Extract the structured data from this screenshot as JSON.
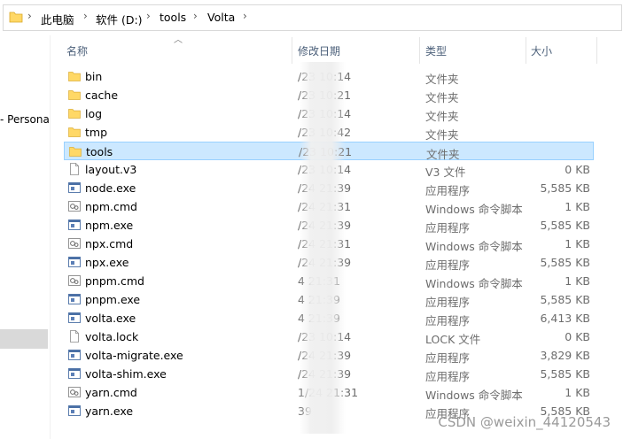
{
  "address_bar": {
    "crumbs": [
      "此电脑",
      "软件 (D:)",
      "tools",
      "Volta"
    ]
  },
  "nav": {
    "item_label": "- Persona"
  },
  "columns": {
    "name": "名称",
    "date": "修改日期",
    "type": "类型",
    "size": "大小"
  },
  "files": [
    {
      "name": "bin",
      "date": "/23 10:14",
      "type": "文件夹",
      "size": "",
      "icon": "folder-icon"
    },
    {
      "name": "cache",
      "date": "/23 10:21",
      "type": "文件夹",
      "size": "",
      "icon": "folder-icon"
    },
    {
      "name": "log",
      "date": "/23 10:14",
      "type": "文件夹",
      "size": "",
      "icon": "folder-icon"
    },
    {
      "name": "tmp",
      "date": "/23 10:42",
      "type": "文件夹",
      "size": "",
      "icon": "folder-icon"
    },
    {
      "name": "tools",
      "date": "/23 10:21",
      "type": "文件夹",
      "size": "",
      "icon": "folder-icon",
      "selected": true
    },
    {
      "name": "layout.v3",
      "date": "/23 10:14",
      "type": "V3 文件",
      "size": "0 KB",
      "icon": "file-icon"
    },
    {
      "name": "node.exe",
      "date": "/24 21:39",
      "type": "应用程序",
      "size": "5,585 KB",
      "icon": "exe-icon"
    },
    {
      "name": "npm.cmd",
      "date": "/24 21:31",
      "type": "Windows 命令脚本",
      "size": "1 KB",
      "icon": "cmd-icon"
    },
    {
      "name": "npm.exe",
      "date": "/24 21:39",
      "type": "应用程序",
      "size": "5,585 KB",
      "icon": "exe-icon"
    },
    {
      "name": "npx.cmd",
      "date": "/24 21:31",
      "type": "Windows 命令脚本",
      "size": "1 KB",
      "icon": "cmd-icon"
    },
    {
      "name": "npx.exe",
      "date": "/24 21:39",
      "type": "应用程序",
      "size": "5,585 KB",
      "icon": "exe-icon"
    },
    {
      "name": "pnpm.cmd",
      "date": "4 21:31",
      "type": "Windows 命令脚本",
      "size": "1 KB",
      "icon": "cmd-icon"
    },
    {
      "name": "pnpm.exe",
      "date": "4 21:39",
      "type": "应用程序",
      "size": "5,585 KB",
      "icon": "exe-icon"
    },
    {
      "name": "volta.exe",
      "date": "4 21:39",
      "type": "应用程序",
      "size": "6,413 KB",
      "icon": "exe-icon"
    },
    {
      "name": "volta.lock",
      "date": "/23 10:14",
      "type": "LOCK 文件",
      "size": "0 KB",
      "icon": "file-icon"
    },
    {
      "name": "volta-migrate.exe",
      "date": "/24 21:39",
      "type": "应用程序",
      "size": "3,829 KB",
      "icon": "exe-icon"
    },
    {
      "name": "volta-shim.exe",
      "date": "/24 21:39",
      "type": "应用程序",
      "size": "5,585 KB",
      "icon": "exe-icon"
    },
    {
      "name": "yarn.cmd",
      "date": "1/24 21:31",
      "type": "Windows 命令脚本",
      "size": "1 KB",
      "icon": "cmd-icon"
    },
    {
      "name": "yarn.exe",
      "date": "39",
      "type": "应用程序",
      "size": "5,585 KB",
      "icon": "exe-icon"
    }
  ],
  "watermark": "CSDN @weixin_44120543",
  "colors": {
    "selection": "#cce8ff",
    "selection_border": "#99d1ff",
    "folder": "#ffd866",
    "header_text": "#4c607a"
  }
}
